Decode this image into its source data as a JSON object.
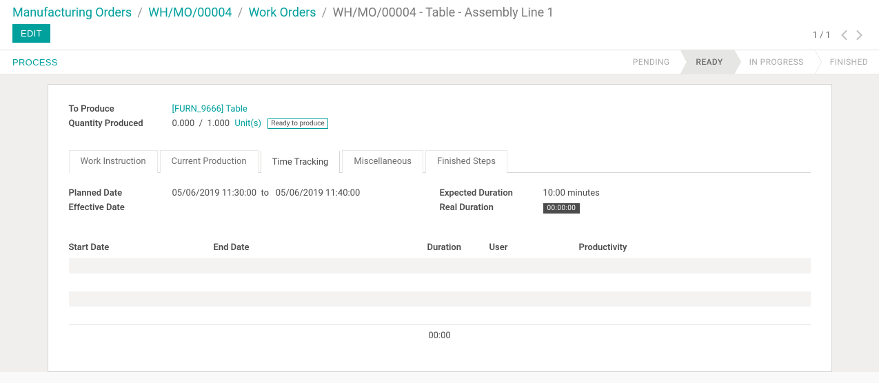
{
  "breadcrumb": {
    "items": [
      "Manufacturing Orders",
      "WH/MO/00004",
      "Work Orders"
    ],
    "current": "WH/MO/00004 - Table - Assembly Line 1"
  },
  "edit_label": "EDIT",
  "pager": {
    "text": "1 / 1"
  },
  "process_label": "PROCESS",
  "status": {
    "steps": [
      "PENDING",
      "READY",
      "IN PROGRESS",
      "FINISHED"
    ],
    "active_index": 1
  },
  "fields": {
    "to_produce_label": "To Produce",
    "to_produce_value": "[FURN_9666] Table",
    "qty_produced_label": "Quantity Produced",
    "qty_done": "0.000",
    "qty_sep": "/",
    "qty_total": "1.000",
    "qty_unit": "Unit(s)",
    "ready_badge": "Ready to produce"
  },
  "tabs": [
    "Work Instruction",
    "Current Production",
    "Time Tracking",
    "Miscellaneous",
    "Finished Steps"
  ],
  "active_tab": 2,
  "time_tracking": {
    "planned_date_label": "Planned Date",
    "planned_from": "05/06/2019 11:30:00",
    "planned_to_word": "to",
    "planned_to": "05/06/2019 11:40:00",
    "effective_date_label": "Effective Date",
    "expected_duration_label": "Expected Duration",
    "expected_duration_value": "10:00 minutes",
    "real_duration_label": "Real Duration",
    "real_duration_value": "00:00:00"
  },
  "table": {
    "headers": {
      "start": "Start Date",
      "end": "End Date",
      "duration": "Duration",
      "user": "User",
      "productivity": "Productivity"
    },
    "footer_total": "00:00"
  }
}
